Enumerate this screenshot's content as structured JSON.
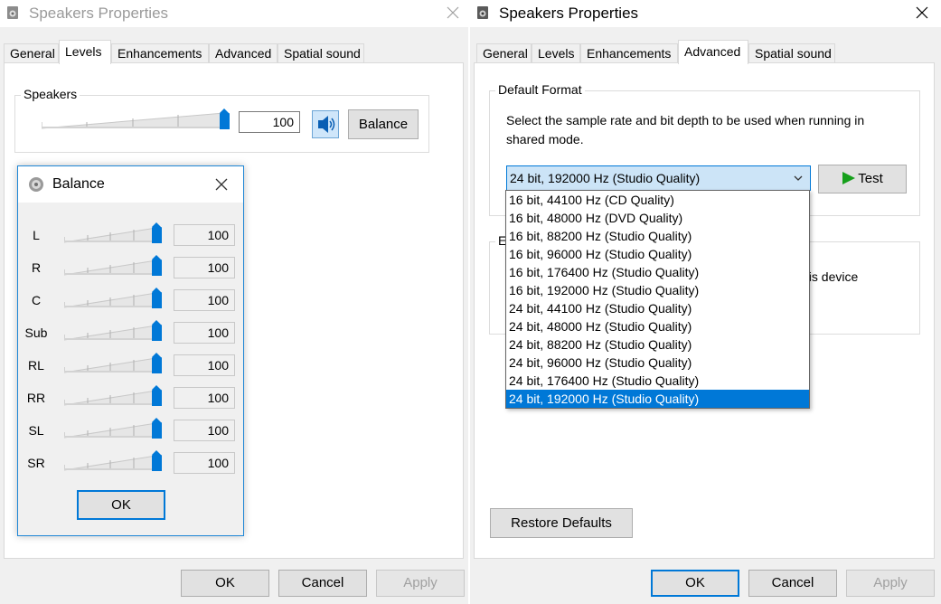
{
  "left_window": {
    "title": "Speakers Properties",
    "tabs": [
      "General",
      "Levels",
      "Enhancements",
      "Advanced",
      "Spatial sound"
    ],
    "active_tab": "Levels",
    "speakers_group": {
      "label": "Speakers",
      "level": "100",
      "level_fraction": 1.0,
      "balance_button": "Balance",
      "speaker_icon": "speaker-volume-icon"
    },
    "buttons": {
      "ok": "OK",
      "cancel": "Cancel",
      "apply": "Apply"
    }
  },
  "balance_dialog": {
    "title": "Balance",
    "channels": [
      {
        "label": "L",
        "value": "100",
        "level_fraction": 1.0
      },
      {
        "label": "R",
        "value": "100",
        "level_fraction": 1.0
      },
      {
        "label": "C",
        "value": "100",
        "level_fraction": 1.0
      },
      {
        "label": "Sub",
        "value": "100",
        "level_fraction": 1.0
      },
      {
        "label": "RL",
        "value": "100",
        "level_fraction": 1.0
      },
      {
        "label": "RR",
        "value": "100",
        "level_fraction": 1.0
      },
      {
        "label": "SL",
        "value": "100",
        "level_fraction": 1.0
      },
      {
        "label": "SR",
        "value": "100",
        "level_fraction": 1.0
      }
    ],
    "ok_button": "OK"
  },
  "right_window": {
    "title": "Speakers Properties",
    "tabs": [
      "General",
      "Levels",
      "Enhancements",
      "Advanced",
      "Spatial sound"
    ],
    "active_tab": "Advanced",
    "default_format": {
      "label": "Default Format",
      "description": "Select the sample rate and bit depth to be used when running in shared mode.",
      "selected": "24 bit, 192000 Hz (Studio Quality)",
      "test_button": "Test",
      "options": [
        "16 bit, 44100 Hz (CD Quality)",
        "16 bit, 48000 Hz (DVD Quality)",
        "16 bit, 88200 Hz (Studio Quality)",
        "16 bit, 96000 Hz (Studio Quality)",
        "16 bit, 176400 Hz (Studio Quality)",
        "16 bit, 192000 Hz (Studio Quality)",
        "24 bit, 44100 Hz (Studio Quality)",
        "24 bit, 48000 Hz (Studio Quality)",
        "24 bit, 88200 Hz (Studio Quality)",
        "24 bit, 96000 Hz (Studio Quality)",
        "24 bit, 176400 Hz (Studio Quality)",
        "24 bit, 192000 Hz (Studio Quality)"
      ],
      "highlighted_index": 11
    },
    "exclusive_group": {
      "label_fragment": "E",
      "text_fragment": "his device"
    },
    "restore_defaults": "Restore Defaults",
    "buttons": {
      "ok": "OK",
      "cancel": "Cancel",
      "apply": "Apply"
    }
  },
  "colors": {
    "accent": "#0078d7",
    "combo_bg": "#cce4f7",
    "window_bg": "#f0f0f0",
    "test_play": "#16a01b"
  }
}
